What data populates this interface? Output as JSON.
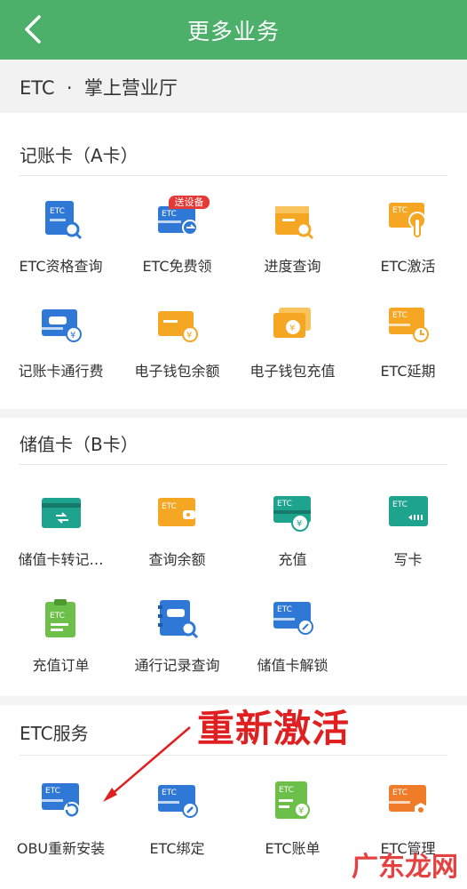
{
  "header": {
    "title": "更多业务"
  },
  "crumb": {
    "text": "ETC  ·  掌上营业厅"
  },
  "sections": {
    "a": {
      "title": "记账卡（A卡）"
    },
    "b": {
      "title": "储值卡（B卡）"
    },
    "c": {
      "title": "ETC服务"
    }
  },
  "items": {
    "a1": "ETC资格查询",
    "a2": "ETC免费领",
    "a3": "进度查询",
    "a4": "ETC激活",
    "a5": "记账卡通行费",
    "a6": "电子钱包余额",
    "a7": "电子钱包充值",
    "a8": "ETC延期",
    "b1": "储值卡转记…",
    "b2": "查询余额",
    "b3": "充值",
    "b4": "写卡",
    "b5": "充值订单",
    "b6": "通行记录查询",
    "b7": "储值卡解锁",
    "c1": "OBU重新安装",
    "c2": "ETC绑定",
    "c3": "ETC账单",
    "c4": "ETC管理"
  },
  "badge": "送设备",
  "icon_text": "ETC",
  "annotation": "重新激活",
  "watermark": "广东龙网",
  "colors": {
    "header": "#4caf6a",
    "blue": "#2f78d6",
    "orange": "#f5a623",
    "teal": "#1ea38e",
    "green": "#6cc04a",
    "red": "#e02020"
  }
}
